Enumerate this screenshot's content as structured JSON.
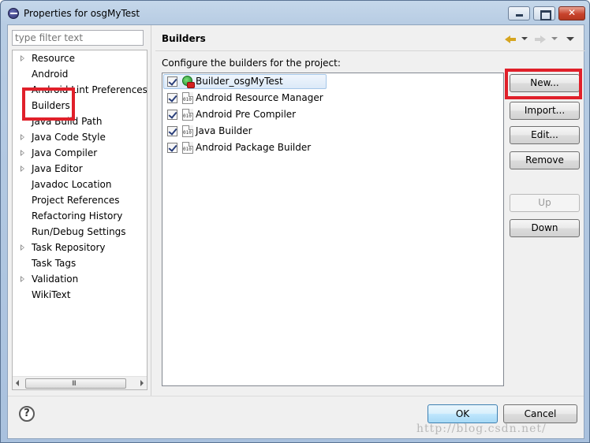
{
  "window": {
    "title": "Properties for osgMyTest",
    "icon": "eclipse-icon"
  },
  "filter": {
    "placeholder": "type filter text"
  },
  "tree": {
    "items": [
      {
        "label": "Resource",
        "expandable": true
      },
      {
        "label": "Android",
        "expandable": false
      },
      {
        "label": "Android Lint Preferences",
        "expandable": false
      },
      {
        "label": "Builders",
        "expandable": false,
        "selected": true
      },
      {
        "label": "Java Build Path",
        "expandable": false
      },
      {
        "label": "Java Code Style",
        "expandable": true
      },
      {
        "label": "Java Compiler",
        "expandable": true
      },
      {
        "label": "Java Editor",
        "expandable": true
      },
      {
        "label": "Javadoc Location",
        "expandable": false
      },
      {
        "label": "Project References",
        "expandable": false
      },
      {
        "label": "Refactoring History",
        "expandable": false
      },
      {
        "label": "Run/Debug Settings",
        "expandable": false
      },
      {
        "label": "Task Repository",
        "expandable": true
      },
      {
        "label": "Task Tags",
        "expandable": false
      },
      {
        "label": "Validation",
        "expandable": true
      },
      {
        "label": "WikiText",
        "expandable": false
      }
    ],
    "scroll_grip": "III"
  },
  "page": {
    "title": "Builders",
    "description": "Configure the builders for the project:",
    "builders": [
      {
        "label": "Builder_osgMyTest",
        "checked": true,
        "icon": "launch-config-icon",
        "selected": true
      },
      {
        "label": "Android Resource Manager",
        "checked": true,
        "icon": "binary-builder-icon"
      },
      {
        "label": "Android Pre Compiler",
        "checked": true,
        "icon": "binary-builder-icon"
      },
      {
        "label": "Java Builder",
        "checked": true,
        "icon": "binary-builder-icon"
      },
      {
        "label": "Android Package Builder",
        "checked": true,
        "icon": "binary-builder-icon"
      }
    ]
  },
  "buttons": {
    "new": "New...",
    "import": "Import...",
    "edit": "Edit...",
    "remove": "Remove",
    "up": "Up",
    "down": "Down",
    "ok": "OK",
    "cancel": "Cancel",
    "help": "?"
  },
  "watermark": "http://blog.csdn.net/",
  "colors": {
    "highlight_box": "#e0202a",
    "selection": "#dbe9f8",
    "default_button": "#bee6fd"
  }
}
